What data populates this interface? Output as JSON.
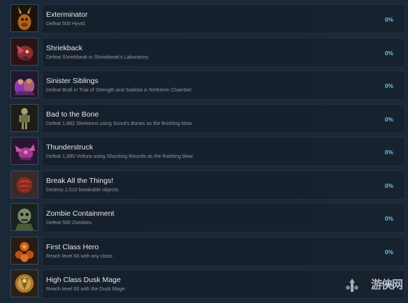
{
  "achievements": [
    {
      "icon": "exterminator-icon",
      "title": "Exterminator",
      "description": "Defeat 500 Hyvid.",
      "percent": "0%"
    },
    {
      "icon": "shriekback-icon",
      "title": "Shriekback",
      "description": "Defeat Shriekbeak in Shriekbeak's Laboratory.",
      "percent": "0%"
    },
    {
      "icon": "sinister-siblings-icon",
      "title": "Sinister Siblings",
      "description": "Defeat Brall in Trial of Strength and Sadista in Netherim Chamber.",
      "percent": "0%"
    },
    {
      "icon": "bad-to-the-bone-icon",
      "title": "Bad to the Bone",
      "description": "Defeat 1,982 Skeletons using Scout's Bones as the finishing blow.",
      "percent": "0%"
    },
    {
      "icon": "thunderstruck-icon",
      "title": "Thunderstruck",
      "description": "Defeat 1,990 Voltura using Shocking Rounds as the finishing blow.",
      "percent": "0%"
    },
    {
      "icon": "break-all-the-things-icon",
      "title": "Break All the Things!",
      "description": "Destroy 2,010 breakable objects.",
      "percent": "0%"
    },
    {
      "icon": "zombie-containment-icon",
      "title": "Zombie Containment",
      "description": "Defeat 500 Zombies.",
      "percent": "0%"
    },
    {
      "icon": "first-class-hero-icon",
      "title": "First Class Hero",
      "description": "Reach level 60 with any class.",
      "percent": "0%"
    },
    {
      "icon": "high-class-dusk-mage-icon",
      "title": "High Class Dusk Mage",
      "description": "Reach level 60 with the Dusk Mage.",
      "percent": "0%"
    }
  ],
  "watermark": {
    "text": "游侠网"
  },
  "colors": {
    "background": "#1b2838",
    "percent": "#66c0f4",
    "title": "#e6e8ea",
    "description": "#8f98a0"
  }
}
